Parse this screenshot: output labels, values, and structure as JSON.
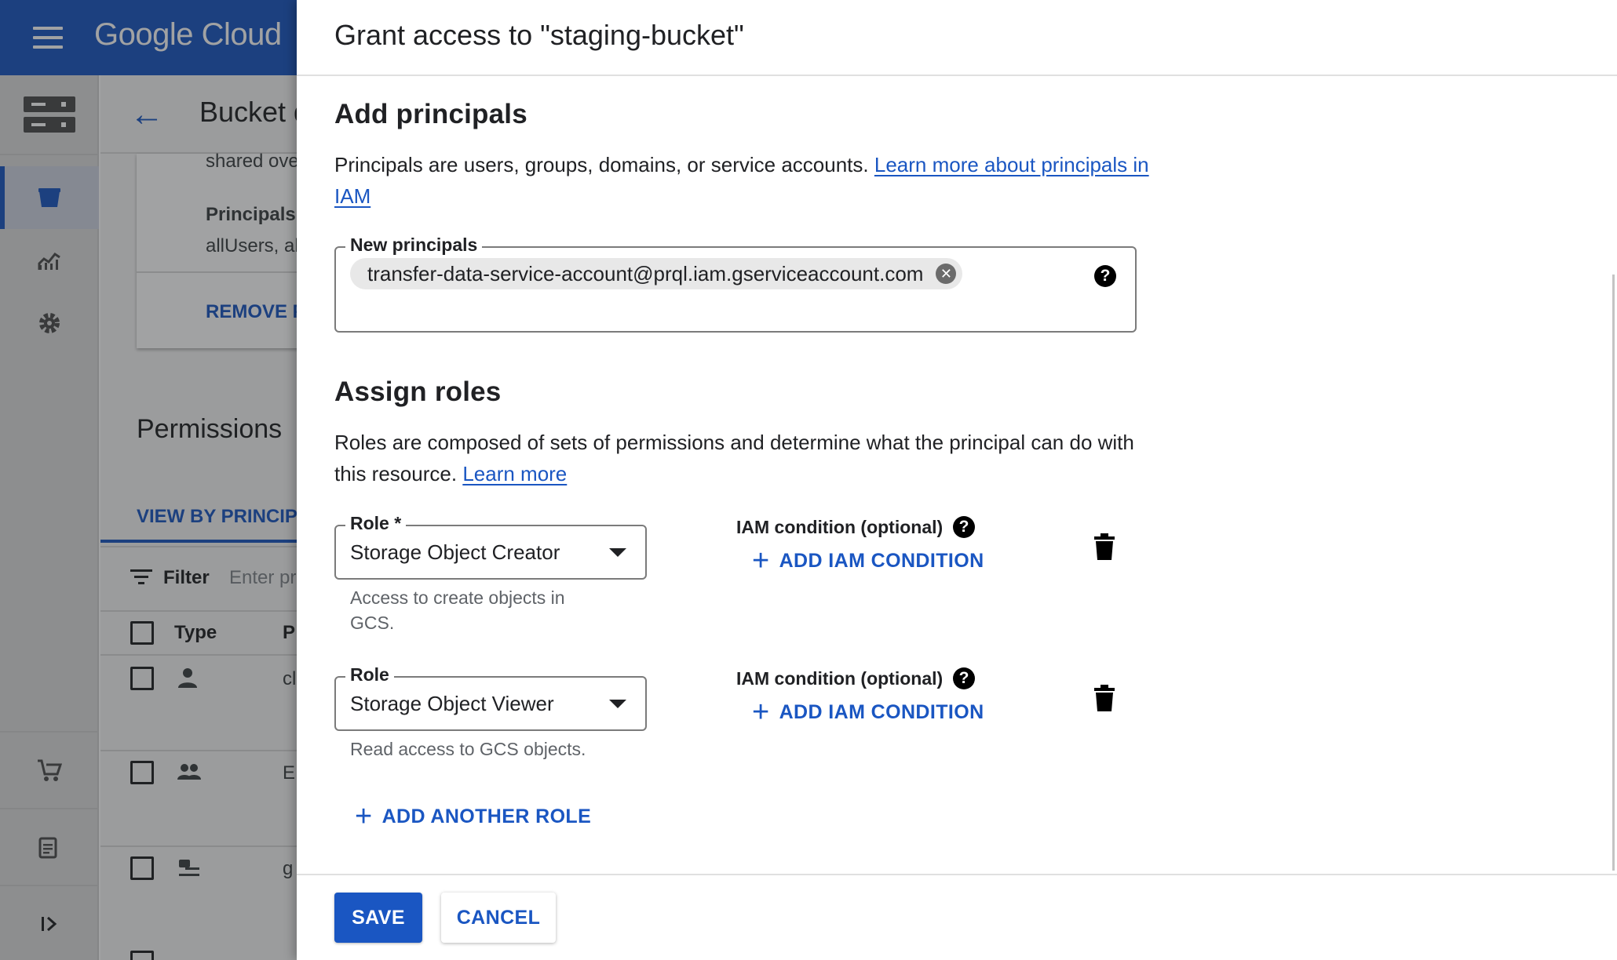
{
  "app": {
    "logo": "Google Cloud",
    "icons": [
      "menu-icon",
      "storage-icon",
      "bucket-icon",
      "monitoring-icon",
      "settings-icon",
      "marketplace-icon",
      "release-notes-icon",
      "expand-icon"
    ]
  },
  "background": {
    "page_title": "Bucket d",
    "card_line1": "shared ove",
    "card_line2": "Principals r",
    "card_line3": "allUsers, al",
    "remove_button": "REMOVE F",
    "permissions_title": "Permissions",
    "tab_view_by_principal": "VIEW BY PRINCIP",
    "filter_label": "Filter",
    "filter_placeholder": "Enter pr",
    "col_type": "Type",
    "col_principal": "P",
    "row1_text": "cl",
    "row2_text": "E",
    "row3_text": "g"
  },
  "panel": {
    "title": "Grant access to \"staging-bucket\"",
    "add_principals": {
      "heading": "Add principals",
      "description": "Principals are users, groups, domains, or service accounts.",
      "link": "Learn more about principals in IAM",
      "field_label": "New principals",
      "chip": "transfer-data-service-account@prql.iam.gserviceaccount.com"
    },
    "assign_roles": {
      "heading": "Assign roles",
      "description": "Roles are composed of sets of permissions and determine what the principal can do with this resource.",
      "link": "Learn more",
      "roles": [
        {
          "label": "Role *",
          "value": "Storage Object Creator",
          "hint": "Access to create objects in GCS.",
          "condition_label": "IAM condition (optional)",
          "condition_button": "ADD IAM CONDITION"
        },
        {
          "label": "Role",
          "value": "Storage Object Viewer",
          "hint": "Read access to GCS objects.",
          "condition_label": "IAM condition (optional)",
          "condition_button": "ADD IAM CONDITION"
        }
      ],
      "add_another_role": "ADD ANOTHER ROLE"
    },
    "save_label": "SAVE",
    "cancel_label": "CANCEL"
  },
  "colors": {
    "accent": "#1a56c2",
    "topbar": "#1a56c2"
  }
}
